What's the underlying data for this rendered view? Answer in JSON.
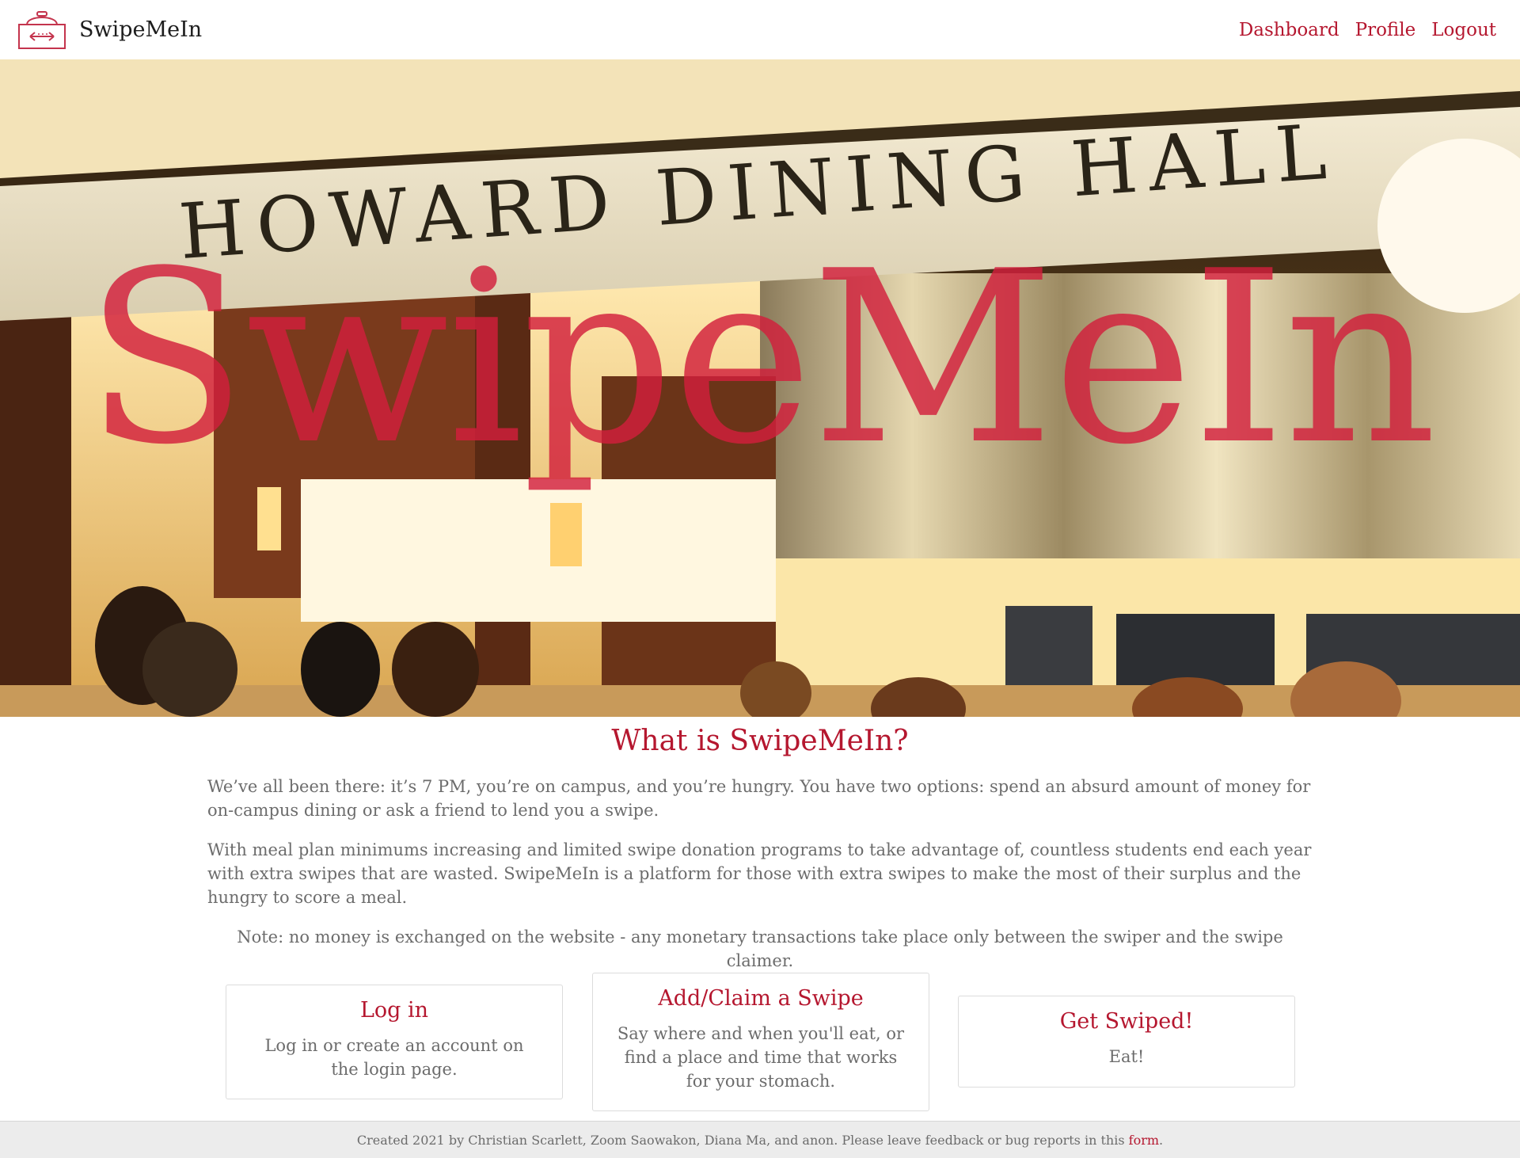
{
  "navbar": {
    "brand_name": "SwipeMeIn",
    "links": [
      "Dashboard",
      "Profile",
      "Logout"
    ]
  },
  "hero": {
    "title": "SwipeMeIn",
    "sign_text": "HOWARD DINING HALL"
  },
  "about": {
    "title": "What is SwipeMeIn?",
    "paragraphs": [
      "We’ve all been there: it’s 7 PM, you’re on campus, and you’re hungry. You have two options: spend an absurd amount of money for on-campus dining or ask a friend to lend you a swipe.",
      "With meal plan minimums increasing and limited swipe donation programs to take advantage of, countless students end each year with extra swipes that are wasted. SwipeMeIn is a platform for those with extra swipes to make the most of their surplus and the hungry to score a meal."
    ],
    "note": "Note: no money is exchanged on the website - any monetary transactions take place only between the swiper and the swipe claimer."
  },
  "cards": [
    {
      "title": "Log in",
      "text": "Log in or create an account on the login page."
    },
    {
      "title": "Add/Claim a Swipe",
      "text": "Say where and when you'll eat, or find a place and time that works for your stomach."
    },
    {
      "title": "Get Swiped!",
      "text": "Eat!"
    }
  ],
  "footer": {
    "text": "Created 2021 by Christian Scarlett, Zoom Saowakon, Diana Ma, and anon. Please leave feedback or bug reports in this",
    "link": "form",
    "suffix": "."
  },
  "colors": {
    "accent": "#b5172f",
    "hero_title": "#d21e3c",
    "text": "#6c6c6c",
    "footer_bg": "#ececec"
  }
}
